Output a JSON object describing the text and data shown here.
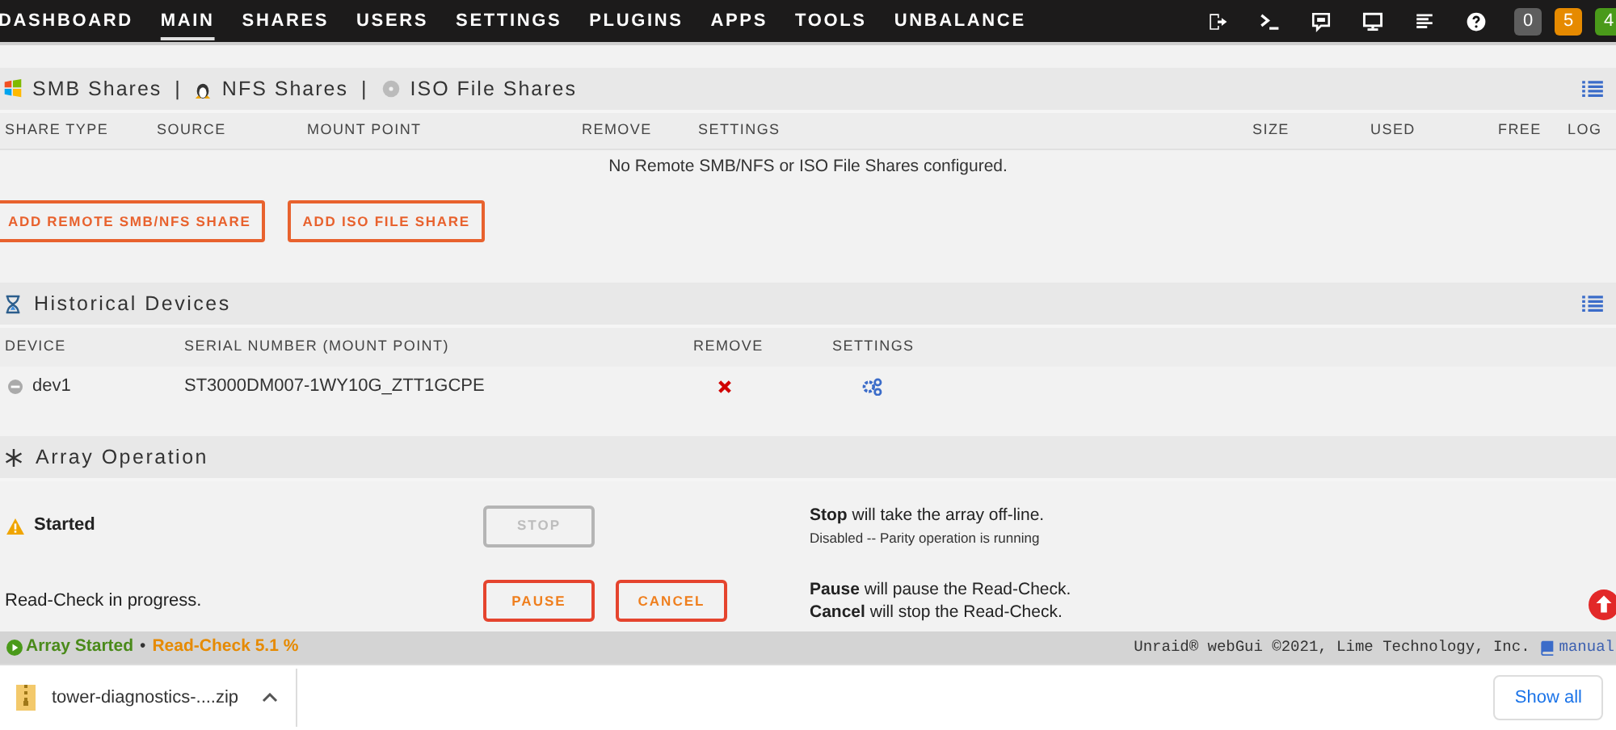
{
  "nav": {
    "tabs": [
      {
        "label": "DASHBOARD",
        "selected": false
      },
      {
        "label": "MAIN",
        "selected": true
      },
      {
        "label": "SHARES",
        "selected": false
      },
      {
        "label": "USERS",
        "selected": false
      },
      {
        "label": "SETTINGS",
        "selected": false
      },
      {
        "label": "PLUGINS",
        "selected": false
      },
      {
        "label": "APPS",
        "selected": false
      },
      {
        "label": "TOOLS",
        "selected": false
      },
      {
        "label": "UNBALANCE",
        "selected": false
      }
    ],
    "badges": [
      {
        "label": "0",
        "color": "#5e5e5e"
      },
      {
        "label": "5",
        "color": "#e68a00"
      },
      {
        "label": "4",
        "color": "#4a9a1a"
      }
    ]
  },
  "remote_shares": {
    "title_parts": [
      {
        "kind": "windows",
        "label": "SMB Shares"
      },
      {
        "kind": "linux",
        "label": "NFS Shares"
      },
      {
        "kind": "disc",
        "label": "ISO File Shares"
      }
    ],
    "separators": [
      "|",
      "|"
    ],
    "columns": [
      "SHARE TYPE",
      "SOURCE",
      "MOUNT POINT",
      "REMOVE",
      "SETTINGS",
      "SIZE",
      "USED",
      "FREE",
      "LOG"
    ],
    "empty_message": "No Remote SMB/NFS or ISO File Shares configured.",
    "buttons": [
      "ADD REMOTE SMB/NFS SHARE",
      "ADD ISO FILE SHARE"
    ]
  },
  "historical_devices": {
    "title": "Historical Devices",
    "columns": [
      "DEVICE",
      "SERIAL NUMBER (MOUNT POINT)",
      "REMOVE",
      "SETTINGS"
    ],
    "rows": [
      {
        "device": "dev1",
        "serial": "ST3000DM007-1WY10G_ZTT1GCPE"
      }
    ]
  },
  "array_operation": {
    "title": "Array Operation",
    "rows": [
      {
        "kind": "warning",
        "status": "Started",
        "buttons": [
          {
            "label": "STOP",
            "disabled": true
          }
        ],
        "notes": [
          "**Stop** will take the array off-line."
        ],
        "subnote": "Disabled -- Parity operation is running"
      },
      {
        "kind": "plain",
        "status": "Read-Check in progress.",
        "buttons": [
          {
            "label": "PAUSE",
            "disabled": false
          },
          {
            "label": "CANCEL",
            "disabled": false
          }
        ],
        "notes": [
          "**Pause** will pause the Read-Check.",
          "**Cancel** will stop the Read-Check."
        ]
      }
    ]
  },
  "status_bar": {
    "array_state": "Array Started",
    "separator": "•",
    "progress": "Read-Check 5.1 %",
    "copyright": "Unraid® webGui ©2021, Lime Technology, Inc.",
    "manual_link": "manual"
  },
  "download_bar": {
    "file": "tower-diagnostics-....zip",
    "show_all": "Show all"
  }
}
